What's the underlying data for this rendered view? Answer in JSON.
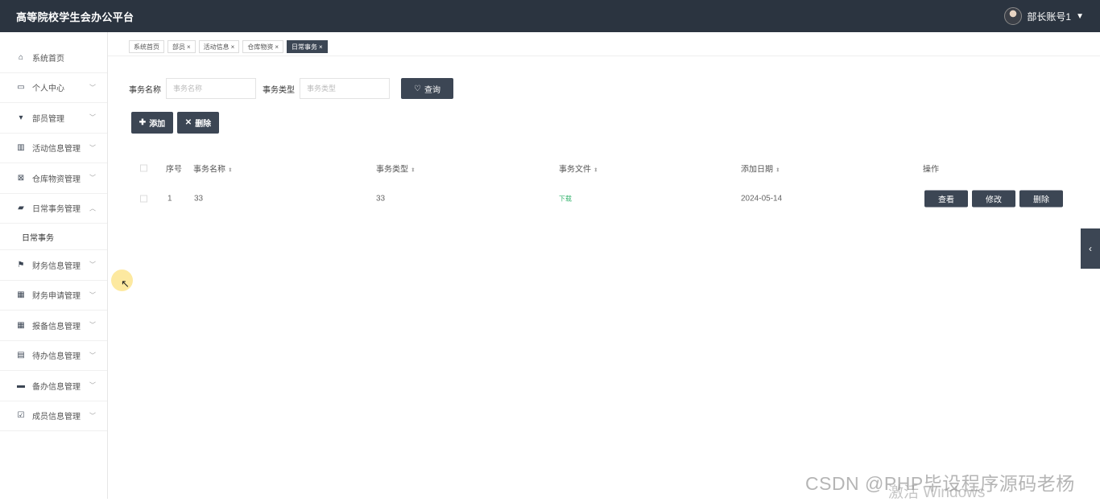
{
  "app": {
    "title": "高等院校学生会办公平台",
    "user": "部长账号1"
  },
  "sidebar": {
    "items": [
      {
        "label": "系统首页",
        "icon": "home-icon"
      },
      {
        "label": "个人中心",
        "icon": "profile-icon"
      },
      {
        "label": "部员管理",
        "icon": "member-icon"
      },
      {
        "label": "活动信息管理",
        "icon": "chart-icon"
      },
      {
        "label": "仓库物资管理",
        "icon": "warehouse-icon"
      },
      {
        "label": "日常事务管理",
        "icon": "briefcase-icon"
      },
      {
        "label": "财务信息管理",
        "icon": "flag-icon"
      },
      {
        "label": "财务申请管理",
        "icon": "grid-icon"
      },
      {
        "label": "报备信息管理",
        "icon": "grid-icon"
      },
      {
        "label": "待办信息管理",
        "icon": "clipboard-icon"
      },
      {
        "label": "备办信息管理",
        "icon": "comment-icon"
      },
      {
        "label": "成员信息管理",
        "icon": "check-icon"
      }
    ],
    "submenu_label": "日常事务"
  },
  "tabs": [
    {
      "label": "系统首页"
    },
    {
      "label": "部员"
    },
    {
      "label": "活动信息"
    },
    {
      "label": "仓库物资"
    },
    {
      "label": "日常事务"
    }
  ],
  "search": {
    "name_label": "事务名称",
    "name_placeholder": "事务名称",
    "type_label": "事务类型",
    "type_placeholder": "事务类型",
    "query_label": "查询"
  },
  "toolbar": {
    "add_label": "添加",
    "delete_label": "删除"
  },
  "table": {
    "headers": {
      "index": "序号",
      "name": "事务名称",
      "type": "事务类型",
      "file": "事务文件",
      "date": "添加日期",
      "ops": "操作"
    },
    "rows": [
      {
        "index": "1",
        "name": "33",
        "type": "33",
        "file": "下载",
        "date": "2024-05-14",
        "view": "查看",
        "edit": "修改",
        "delete": "删除"
      }
    ]
  },
  "watermark": {
    "line1": "CSDN @PHP毕设程序源码老杨",
    "line2": "激活 Windows"
  },
  "colors": {
    "accent": "#3c4654",
    "topbar": "#2b3440",
    "link": "#35b36e"
  }
}
